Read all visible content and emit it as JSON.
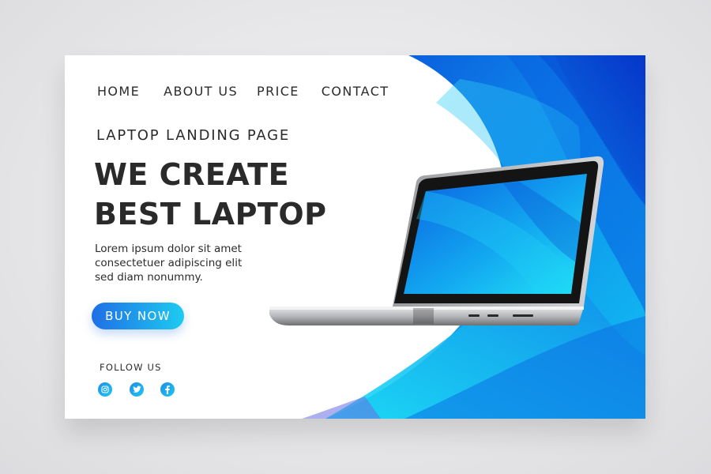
{
  "nav": {
    "items": [
      {
        "label": "HOME"
      },
      {
        "label": "ABOUT US"
      },
      {
        "label": "PRICE"
      },
      {
        "label": "CONTACT"
      }
    ]
  },
  "hero": {
    "subtitle": "LAPTOP LANDING PAGE",
    "headline_line1": "WE CREATE",
    "headline_line2": "BEST LAPTOP",
    "body_line1": "Lorem ipsum dolor sit amet",
    "body_line2": "consectetuer adipiscing elit",
    "body_line3": "sed diam nonummy.",
    "cta_label": "BUY NOW"
  },
  "social": {
    "follow_label": "FOLLOW US",
    "icons": [
      "instagram-icon",
      "twitter-icon",
      "facebook-icon"
    ]
  },
  "colors": {
    "accent_blue": "#1f6fe6",
    "accent_cyan": "#1ecbf0",
    "text_dark": "#2b2b2b",
    "background": "#ffffff"
  }
}
